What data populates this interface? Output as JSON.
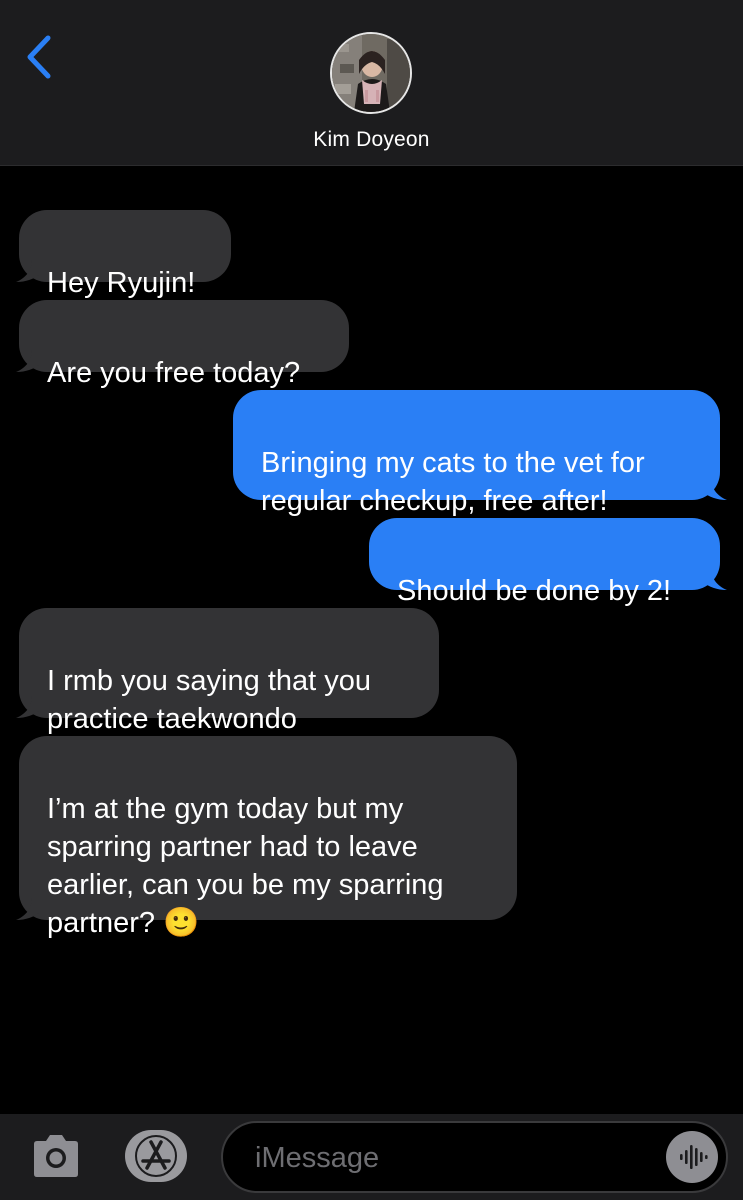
{
  "header": {
    "back_icon": "chevron-left-icon",
    "contact_name": "Kim Doyeon",
    "accent_color": "#2a7ff5"
  },
  "messages": [
    {
      "direction": "received",
      "text": "Hey Ryujin!"
    },
    {
      "direction": "received",
      "text": "Are you free today?"
    },
    {
      "direction": "sent",
      "text": "Bringing my cats to the vet for\nregular checkup, free after!"
    },
    {
      "direction": "sent",
      "text": "Should be done by 2!"
    },
    {
      "direction": "received",
      "text": "I rmb you saying that you\npractice taekwondo"
    },
    {
      "direction": "received",
      "text": "I’m at the gym today but my\nsparring partner had to leave\nearlier, can you be my sparring\npartner? 🙂"
    }
  ],
  "input_bar": {
    "camera_icon": "camera-icon",
    "appstore_icon": "app-store-icon",
    "placeholder": "iMessage",
    "audio_icon": "audio-waveform-icon"
  },
  "colors": {
    "sent_bubble": "#2a7ff5",
    "received_bubble": "#333335",
    "background": "#000000"
  }
}
